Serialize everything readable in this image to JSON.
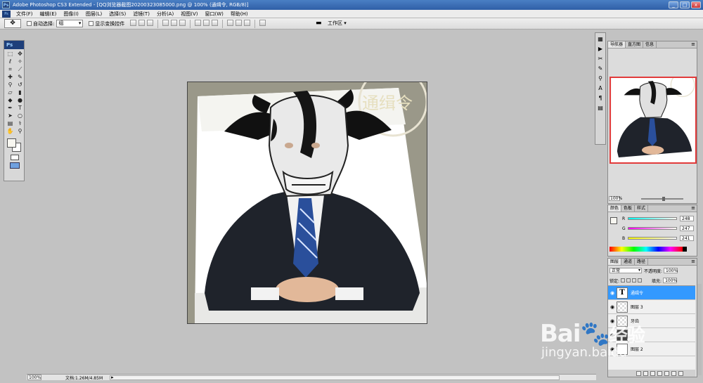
{
  "window": {
    "title": "Adobe Photoshop CS3 Extended - [QQ浏览器截图20200323085000.png @ 100% (通缉令, RGB/8)]",
    "app_logo": "Ps",
    "minimize": "_",
    "maximize": "□",
    "close": "x"
  },
  "menu": [
    "文件(F)",
    "编辑(E)",
    "图像(I)",
    "图层(L)",
    "选择(S)",
    "滤镜(T)",
    "分析(A)",
    "视图(V)",
    "窗口(W)",
    "帮助(H)"
  ],
  "options": {
    "auto_select_label": "自动选择:",
    "auto_select_value": "组",
    "show_transform_label": "显示变换控件",
    "workspace_label": "工作区 ▾"
  },
  "toolbox": {
    "header": "Ps"
  },
  "document": {
    "stamp_text": "通缉令"
  },
  "status": {
    "zoom": "100%",
    "doc_info": "文档:1.26M/4.85M"
  },
  "navigator": {
    "tabs": [
      "导航器",
      "直方图",
      "信息"
    ],
    "zoom": "100%"
  },
  "color_panel": {
    "tabs": [
      "颜色",
      "色板",
      "样式"
    ],
    "r_label": "R",
    "g_label": "G",
    "b_label": "B",
    "r": "248",
    "g": "247",
    "b": "241",
    "foreground": "#f8f7f1"
  },
  "layers_panel": {
    "tabs": [
      "图层",
      "通道",
      "路径"
    ],
    "blend_mode": "正常",
    "opacity_label": "不透明度:",
    "opacity": "100%",
    "lock_label": "锁定:",
    "fill_label": "填充:",
    "fill": "100%",
    "layers": [
      {
        "name": "通缉令",
        "selected": true
      },
      {
        "name": "图层 3",
        "selected": false
      },
      {
        "name": "牙齿",
        "selected": false
      },
      {
        "name": "",
        "selected": false
      },
      {
        "name": "图层 2",
        "selected": false
      }
    ]
  },
  "watermark": {
    "logo_left": "Bai",
    "logo_right": "经验",
    "sub": "jingyan.baidu"
  },
  "colors": {
    "selection": "#3399ff",
    "navigator_frame": "#e23b3b"
  }
}
